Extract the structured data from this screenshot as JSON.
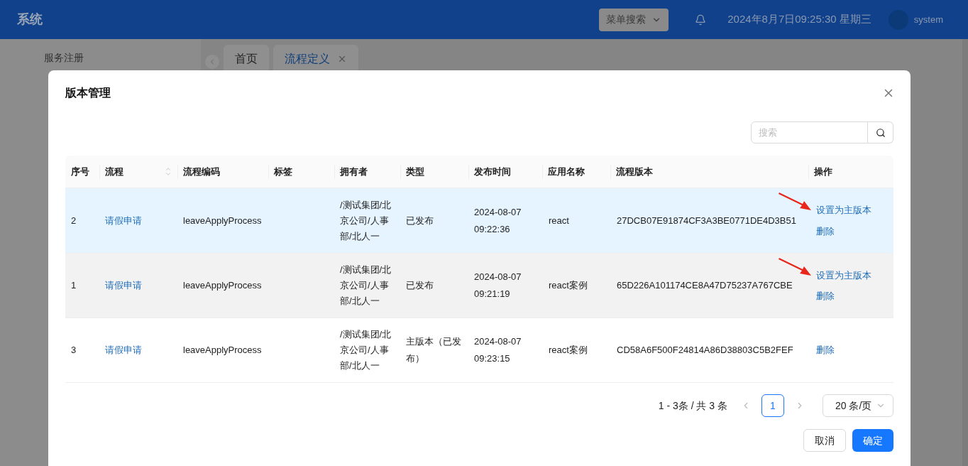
{
  "header": {
    "title": "系统",
    "menu_search": {
      "placeholder": "菜单搜索"
    },
    "datetime": "2024年8月7日09:25:30 星期三",
    "user": "system"
  },
  "sidebar": {
    "items": [
      {
        "label": "服务注册"
      }
    ]
  },
  "tabs": [
    {
      "label": "首页",
      "selected": false,
      "closable": false
    },
    {
      "label": "流程定义",
      "selected": true,
      "closable": true
    }
  ],
  "dialog": {
    "title": "版本管理",
    "search": {
      "placeholder": "搜索"
    },
    "table": {
      "columns": [
        {
          "label": "序号",
          "sortable": false
        },
        {
          "label": "流程",
          "sortable": true
        },
        {
          "label": "流程编码",
          "sortable": false
        },
        {
          "label": "标签",
          "sortable": false
        },
        {
          "label": "拥有者",
          "sortable": false
        },
        {
          "label": "类型",
          "sortable": false
        },
        {
          "label": "发布时间",
          "sortable": false
        },
        {
          "label": "应用名称",
          "sortable": false
        },
        {
          "label": "流程版本",
          "sortable": false
        },
        {
          "label": "操作",
          "sortable": false
        }
      ],
      "rows": [
        {
          "selected": true,
          "hovered": false,
          "marked": true,
          "cells": [
            "2",
            "请假申请",
            "leaveApplyProcess",
            "",
            "/测试集团/北京公司/人事部/北人一",
            "已发布",
            "2024-08-07 09:22:36",
            "react",
            "27DCB07E91874CF3A3BE0771DE4D3B51"
          ],
          "actions": [
            "设置为主版本",
            "删除"
          ]
        },
        {
          "selected": false,
          "hovered": true,
          "marked": true,
          "cells": [
            "1",
            "请假申请",
            "leaveApplyProcess",
            "",
            "/测试集团/北京公司/人事部/北人一",
            "已发布",
            "2024-08-07 09:21:19",
            "react案例",
            "65D226A101174CE8A47D75237A767CBE"
          ],
          "actions": [
            "设置为主版本",
            "删除"
          ]
        },
        {
          "selected": false,
          "hovered": false,
          "marked": false,
          "cells": [
            "3",
            "请假申请",
            "leaveApplyProcess",
            "",
            "/测试集团/北京公司/人事部/北人一",
            "主版本（已发布）",
            "2024-08-07 09:23:15",
            "react案例",
            "CD58A6F500F24814A86D38803C5B2FEF"
          ],
          "actions": [
            "删除"
          ]
        }
      ]
    },
    "pagination": {
      "summary": "1 - 3条 / 共 3 条",
      "pages": [
        {
          "label": "1",
          "selected": true
        }
      ],
      "page_size": "20 条/页"
    },
    "buttons": [
      {
        "label": "取消",
        "kind": "default"
      },
      {
        "label": "确定",
        "kind": "primary"
      }
    ]
  }
}
